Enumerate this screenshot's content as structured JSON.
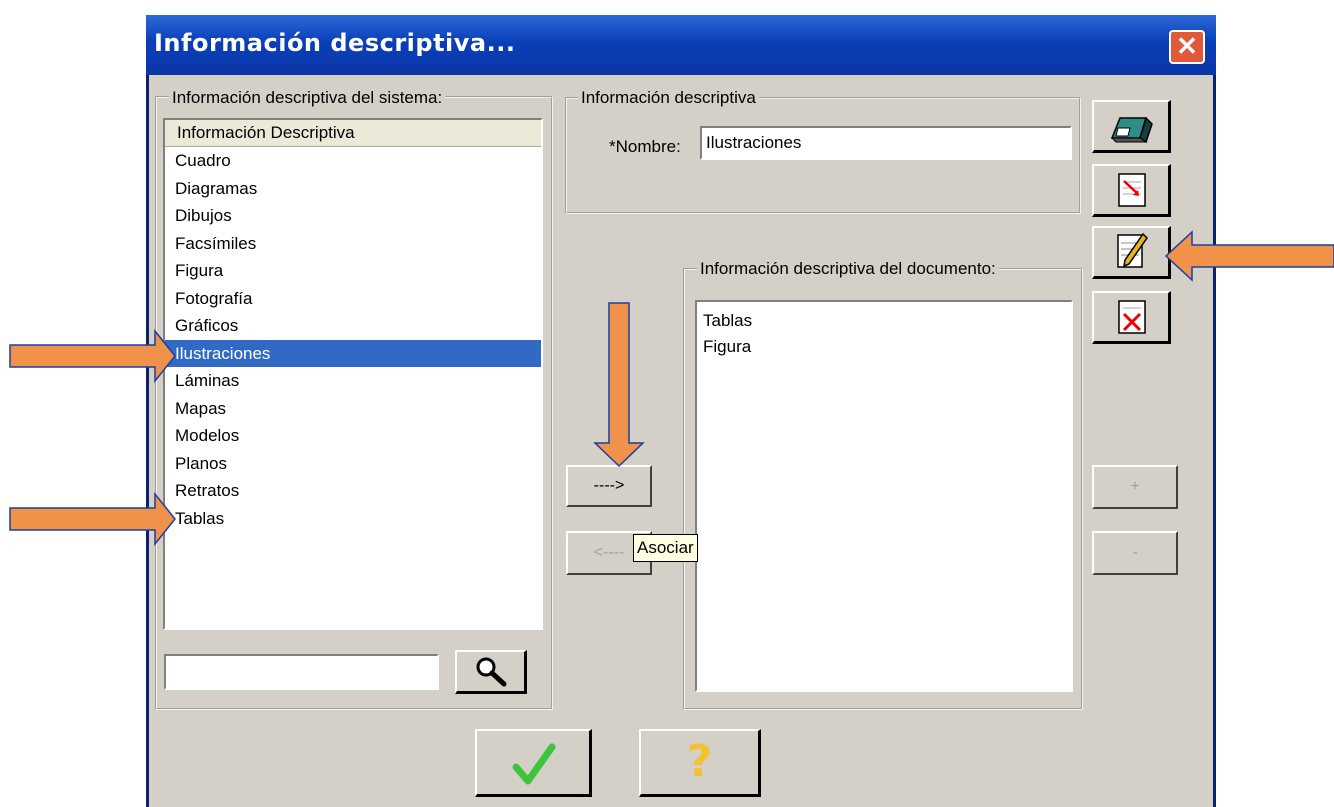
{
  "window": {
    "title": "Información descriptiva...",
    "close_icon": "close-icon"
  },
  "system_panel": {
    "legend": "Información descriptiva del sistema:",
    "column_header": "Información Descriptiva",
    "items": [
      "Cuadro",
      "Diagramas",
      "Dibujos",
      "Facsímiles",
      "Figura",
      "Fotografía",
      "Gráficos",
      "Ilustraciones",
      "Láminas",
      "Mapas",
      "Modelos",
      "Planos",
      "Retratos",
      "Tablas"
    ],
    "selected": "Ilustraciones",
    "search_value": "",
    "search_icon": "magnifier-icon"
  },
  "info_panel": {
    "legend": "Información descriptiva",
    "name_label": "*Nombre:",
    "name_value": "Ilustraciones"
  },
  "document_panel": {
    "legend": "Información descriptiva del documento:",
    "items": [
      "Tablas",
      "Figura"
    ]
  },
  "buttons": {
    "associate": "---->",
    "dissociate": "<----",
    "plus": "+",
    "minus": "-"
  },
  "tooltip": "Asociar",
  "toolbar_icons": [
    "eraser-icon",
    "export-icon",
    "edit-icon",
    "delete-icon"
  ],
  "footer_icons": [
    "checkmark-icon",
    "help-icon"
  ],
  "footer": {
    "help_label": "?"
  },
  "colors": {
    "titlebar": "#0a3fb8",
    "selection": "#316ac5",
    "arrow": "#f0924a"
  }
}
